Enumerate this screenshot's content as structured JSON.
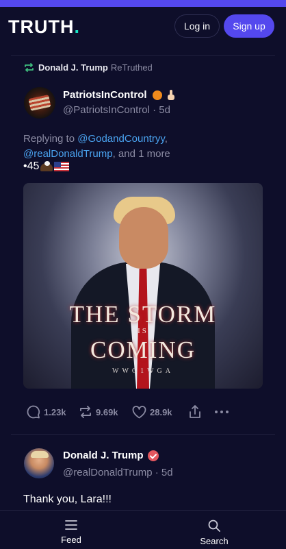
{
  "header": {
    "logo_text": "TRUTH",
    "logo_dot": ".",
    "login_label": "Log in",
    "signup_label": "Sign up"
  },
  "retruth": {
    "name": "Donald J. Trump",
    "label": "ReTruthed"
  },
  "post1": {
    "display_name": "PatriotsInControl",
    "handle": "@PatriotsInControl",
    "time": "5d",
    "reply_prefix": "Replying to",
    "reply_mention1": "@GodandCountryy",
    "reply_mention2": "@realDonaldTrump",
    "reply_suffix": ", and 1 more",
    "text": "•45",
    "image": {
      "title_line1": "THE STORM",
      "title_is": "IS",
      "title_line2": "COMING",
      "tagline": "WWG1WGA"
    },
    "actions": {
      "replies": "1.23k",
      "retruths": "9.69k",
      "likes": "28.9k"
    }
  },
  "post2": {
    "display_name": "Donald J. Trump",
    "handle": "@realDonaldTrump",
    "time": "5d",
    "text": "Thank you, Lara!!!"
  },
  "nav": {
    "feed_label": "Feed",
    "search_label": "Search"
  },
  "colors": {
    "brand_purple": "#5448ee",
    "background": "#0e0e2a",
    "mention": "#4aa3f0",
    "retruth_green": "#3fbf7f",
    "verified": "#e4575f"
  },
  "icons": [
    "retruth-icon",
    "reply-icon",
    "like-icon",
    "share-icon",
    "more-icon",
    "feed-icon",
    "search-icon",
    "verified-icon"
  ]
}
